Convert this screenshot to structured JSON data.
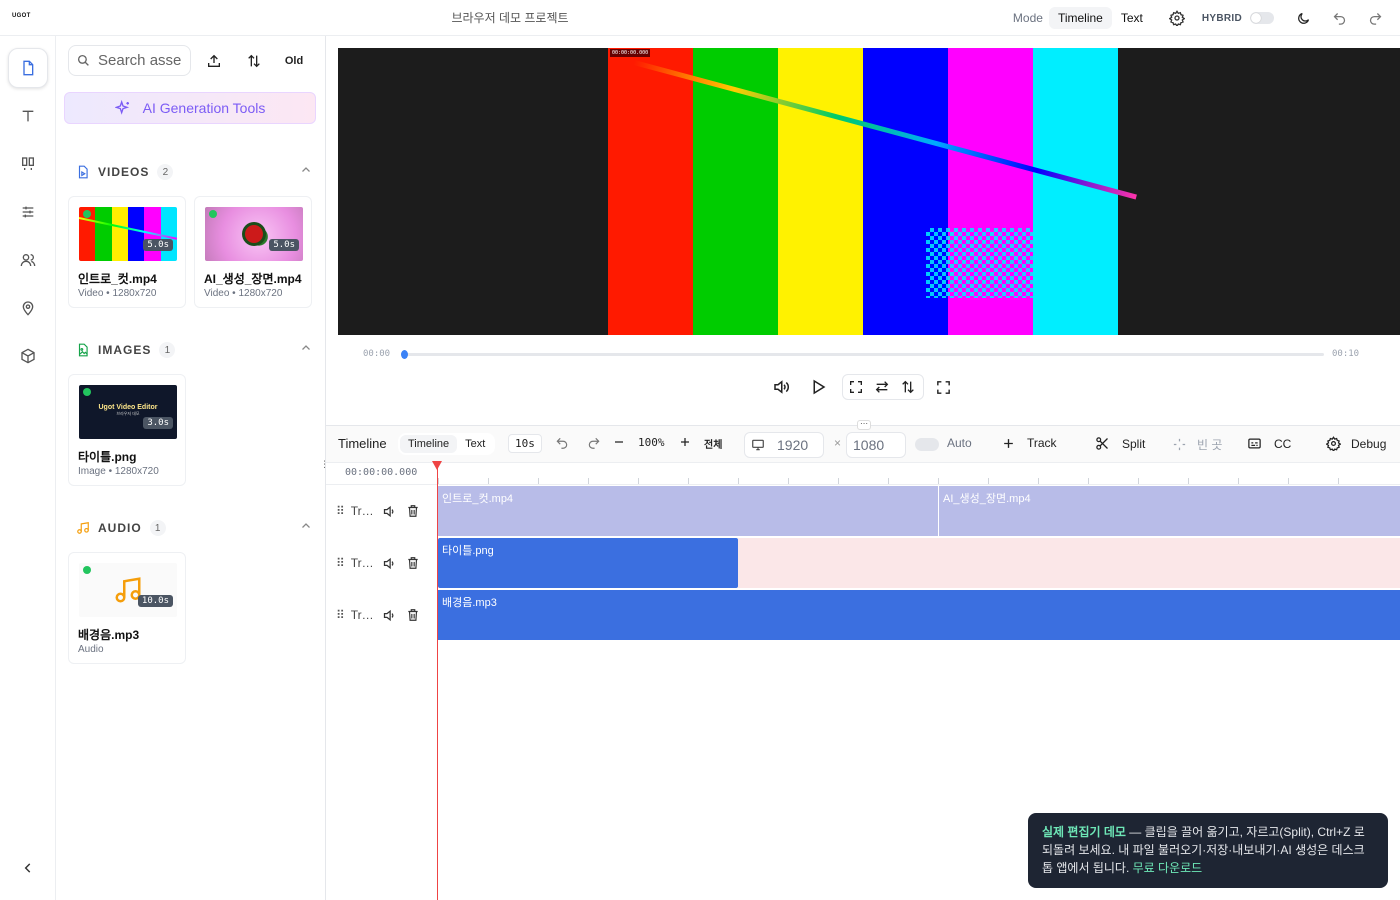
{
  "app": {
    "logo": "UGOT",
    "project_title": "브라우저 데모 프로젝트"
  },
  "topbar": {
    "mode_label": "Mode",
    "mode_options": [
      "Timeline",
      "Text"
    ],
    "mode_active": "Timeline",
    "hybrid_label": "HYBRID",
    "hybrid_on": false
  },
  "rail": {
    "items": [
      "media",
      "text",
      "templates",
      "adjust",
      "people",
      "location",
      "3d"
    ],
    "active": "media",
    "collapse": "collapse"
  },
  "panel": {
    "search_placeholder": "Search asse",
    "sort_label": "Old",
    "ai_tools_label": "AI Generation Tools",
    "sections": [
      {
        "title": "VIDEOS",
        "count": "2"
      },
      {
        "title": "IMAGES",
        "count": "1"
      },
      {
        "title": "AUDIO",
        "count": "1"
      }
    ],
    "videos": [
      {
        "name": "인트로_컷.mp4",
        "meta": "Video • 1280x720",
        "duration": "5.0s"
      },
      {
        "name": "AI_생성_장면.mp4",
        "meta": "Video • 1280x720",
        "duration": "5.0s"
      }
    ],
    "images": [
      {
        "name": "타이틀.png",
        "meta": "Image • 1280x720",
        "duration": "3.0s",
        "thumb_title": "Ugot Video Editor",
        "thumb_sub": "브라우저 데모"
      }
    ],
    "audio": [
      {
        "name": "배경음.mp3",
        "meta": "Audio",
        "duration": "10.0s"
      }
    ]
  },
  "preview": {
    "timecode": "00:00:00.000",
    "time_start": "00:00",
    "time_end": "00:10",
    "progress": 0
  },
  "timeline": {
    "title": "Timeline",
    "modes": [
      "Timeline",
      "Text"
    ],
    "duration_chip": "10s",
    "zoom": "100%",
    "fit_label": "전체",
    "width": "1920",
    "height": "1080",
    "times_sign": "×",
    "auto_label": "Auto",
    "track_label": "Track",
    "split_label": "Split",
    "gap_label": "빈 곳",
    "cc_label": "CC",
    "debug_label": "Debug",
    "timecode": "00:00:00.000",
    "tracks": [
      {
        "name": "Tr…",
        "clips": [
          {
            "label": "인트로_컷.mp4"
          },
          {
            "label": "AI_생성_장면.mp4"
          }
        ]
      },
      {
        "name": "Tr…",
        "clips": [
          {
            "label": "타이틀.png"
          }
        ]
      },
      {
        "name": "Tr…",
        "clips": [
          {
            "label": "배경음.mp3"
          }
        ]
      }
    ]
  },
  "toast": {
    "bold": "실제 편집기 데모",
    "text": " — 클립을 끌어 옮기고, 자르고(Split), Ctrl+Z 로 되돌려 보세요. 내 파일 불러오기·저장·내보내기·AI 생성은 데스크톱 앱에서 됩니다. ",
    "link": "무료 다운로드"
  },
  "colors": {
    "accent": "#3b6fe0",
    "clip_video": "#b8bce8",
    "clip_blue": "#3b6fe0",
    "clip_pink_bg": "#fbe7e8",
    "playhead": "#ef4444"
  }
}
